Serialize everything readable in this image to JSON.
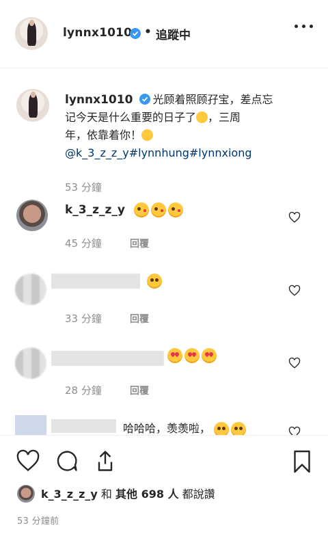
{
  "header": {
    "username": "lynnx1010",
    "separator": "•",
    "follow_status": "追蹤中"
  },
  "caption": {
    "username": "lynnx1010",
    "text_line1": "光顾着照顾孖宝，差点忘",
    "text_line2": "记今天是什么重要的日子了",
    "text_line2_after": "，三周",
    "text_line3": "年，依靠着你！",
    "tags": "@k_3_z_z_y#lynnhung#lynnxiong",
    "time": "53 分鐘"
  },
  "comments": [
    {
      "username": "k_3_z_z_y",
      "emojis": [
        "kiss",
        "kiss",
        "kiss"
      ],
      "time": "45 分鐘",
      "reply": "回覆"
    },
    {
      "username": "",
      "emojis": [
        "smile"
      ],
      "time": "33 分鐘",
      "reply": "回覆"
    },
    {
      "username": "",
      "emojis": [
        "heart",
        "heart",
        "heart"
      ],
      "time": "28 分鐘",
      "reply": "回覆"
    },
    {
      "username": "",
      "text": "哈哈哈，羡羡啦，",
      "emojis": [
        "laugh",
        "laugh"
      ]
    }
  ],
  "likes": {
    "user": "k_3_z_z_y",
    "and": "和",
    "others": "其他 698 人",
    "suffix": "都說讚"
  },
  "time_ago": "53 分鐘前",
  "icons": {
    "like": "heart-icon",
    "comment": "comment-icon",
    "share": "share-icon",
    "save": "bookmark-icon",
    "verified": "verified-badge-icon",
    "more": "more-options-icon"
  },
  "colors": {
    "verified": "#3897f0",
    "link": "#003569",
    "secondary_text": "#8e8e8e"
  }
}
